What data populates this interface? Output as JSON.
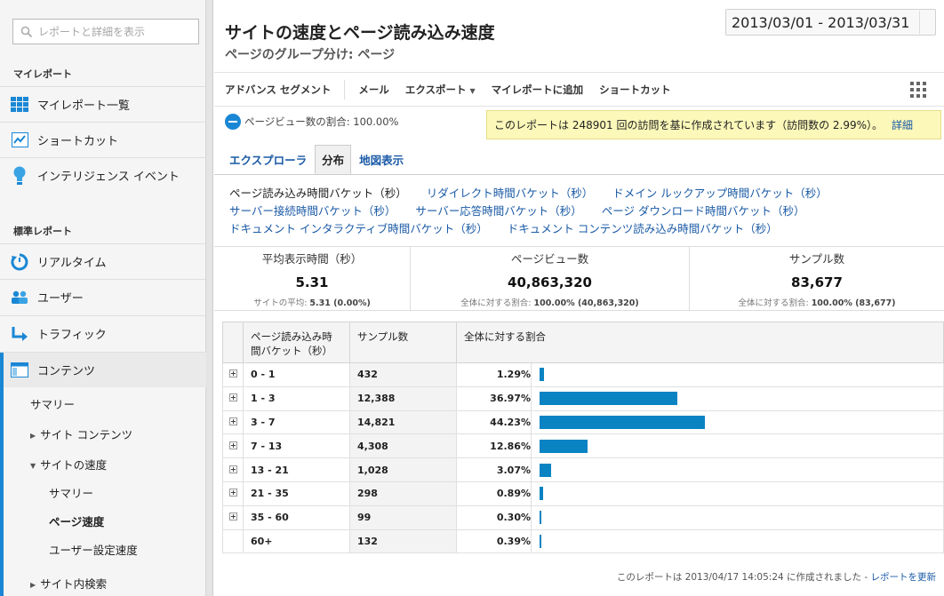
{
  "sidebar": {
    "search_placeholder": "レポートと詳細を表示",
    "my_reports_heading": "マイレポート",
    "standard_reports_heading": "標準レポート",
    "items": [
      {
        "label": "マイレポート一覧"
      },
      {
        "label": "ショートカット"
      },
      {
        "label": "インテリジェンス イベント"
      },
      {
        "label": "リアルタイム"
      },
      {
        "label": "ユーザー"
      },
      {
        "label": "トラフィック"
      },
      {
        "label": "コンテンツ"
      }
    ],
    "content_sub": {
      "summary": "サマリー",
      "site_content": "サイト コンテンツ",
      "site_speed": "サイトの速度",
      "speed_summary": "サマリー",
      "page_timings": "ページ速度",
      "user_timings": "ユーザー設定速度",
      "site_search": "サイト内検索"
    }
  },
  "header": {
    "title": "サイトの速度とページ読み込み速度",
    "subtitle": "ページのグループ分け: ページ",
    "date_range": "2013/03/01 - 2013/03/31"
  },
  "toolbar": {
    "advanced_segments": "アドバンス セグメント",
    "email": "メール",
    "export": "エクスポート",
    "add_to_dashboard": "マイレポートに追加",
    "shortcut": "ショートカット"
  },
  "metric_selector": "ページビュー数の割合: 100.00%",
  "notice": {
    "text": "このレポートは 248901 回の訪問を基に作成されています（訪問数の 2.99%）。",
    "detail_link": "詳細"
  },
  "tabs": [
    "エクスプローラ",
    "分布",
    "地図表示"
  ],
  "bucket_links": [
    [
      "ページ読み込み時間バケット（秒）",
      "リダイレクト時間バケット（秒）",
      "ドメイン ルックアップ時間バケット（秒）"
    ],
    [
      "サーバー接続時間バケット（秒）",
      "サーバー応答時間バケット（秒）",
      "ページ ダウンロード時間バケット（秒）"
    ],
    [
      "ドキュメント インタラクティブ時間バケット（秒）",
      "ドキュメント コンテンツ読み込み時間バケット（秒）"
    ]
  ],
  "scorecards": [
    {
      "title": "平均表示時間（秒）",
      "value": "5.31",
      "sub_label": "サイトの平均:",
      "sub_value": "5.31 (0.00%)"
    },
    {
      "title": "ページビュー数",
      "value": "40,863,320",
      "sub_label": "全体に対する割合:",
      "sub_value": "100.00% (40,863,320)"
    },
    {
      "title": "サンプル数",
      "value": "83,677",
      "sub_label": "全体に対する割合:",
      "sub_value": "100.00% (83,677)"
    }
  ],
  "table": {
    "headers": [
      "ページ読み込み時間バケット（秒）",
      "サンプル数",
      "全体に対する割合"
    ]
  },
  "chart_data": {
    "type": "bar",
    "categories": [
      "0 - 1",
      "1 - 3",
      "3 - 7",
      "7 - 13",
      "13 - 21",
      "21 - 35",
      "35 - 60",
      "60+"
    ],
    "samples": [
      "432",
      "12,388",
      "14,821",
      "4,308",
      "1,028",
      "298",
      "99",
      "132"
    ],
    "percent_labels": [
      "1.29%",
      "36.97%",
      "44.23%",
      "12.86%",
      "3.07%",
      "0.89%",
      "0.30%",
      "0.39%"
    ],
    "values": [
      1.29,
      36.97,
      44.23,
      12.86,
      3.07,
      0.89,
      0.3,
      0.39
    ],
    "expandable": [
      true,
      true,
      true,
      true,
      true,
      true,
      true,
      false
    ]
  },
  "footer": {
    "text": "このレポートは 2013/04/17 14:05:24 に作成されました -",
    "refresh_link": "レポートを更新"
  }
}
